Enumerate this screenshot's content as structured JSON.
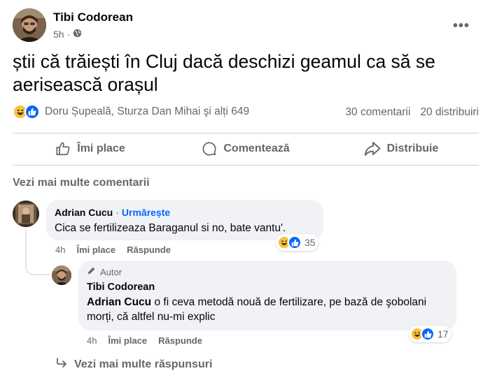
{
  "post": {
    "author": "Tibi Codorean",
    "time": "5h",
    "audience_icon": "globe-icon",
    "more_icon": "ellipsis-icon",
    "text": "știi că trăiești în Cluj dacă deschizi geamul ca să se aerisească orașul"
  },
  "stats": {
    "reaction_icons": [
      "haha-icon",
      "like-icon"
    ],
    "reactors": "Doru Șupeală, Sturza Dan Mihai şi alți 649",
    "comments": "30 comentarii",
    "shares": "20 distribuiri"
  },
  "actions": {
    "like": "Îmi place",
    "comment": "Comentează",
    "share": "Distribuie"
  },
  "more_comments": "Vezi mai multe comentarii",
  "comments": [
    {
      "name": "Adrian Cucu",
      "separator": "·",
      "follow": "Urmărește",
      "text": "Cica se fertilizeaza Baraganul si no, bate vantu'.",
      "time": "4h",
      "like": "Îmi place",
      "reply": "Răspunde",
      "reaction_count": "35"
    }
  ],
  "reply": {
    "badge": "Autor",
    "name": "Tibi Codorean",
    "mention": "Adrian Cucu",
    "text": " o fi ceva metodă nouă de fertilizare, pe bază de şobolani morți, că altfel nu-mi explic",
    "time": "4h",
    "like": "Îmi place",
    "reply": "Răspunde",
    "reaction_count": "17"
  },
  "more_replies": "Vezi mai multe răspunsuri",
  "colors": {
    "accent": "#0866ff",
    "secondary_text": "#65676b",
    "bubble": "#f0f2f5",
    "haha": "#f7b125",
    "like": "#0866ff"
  }
}
